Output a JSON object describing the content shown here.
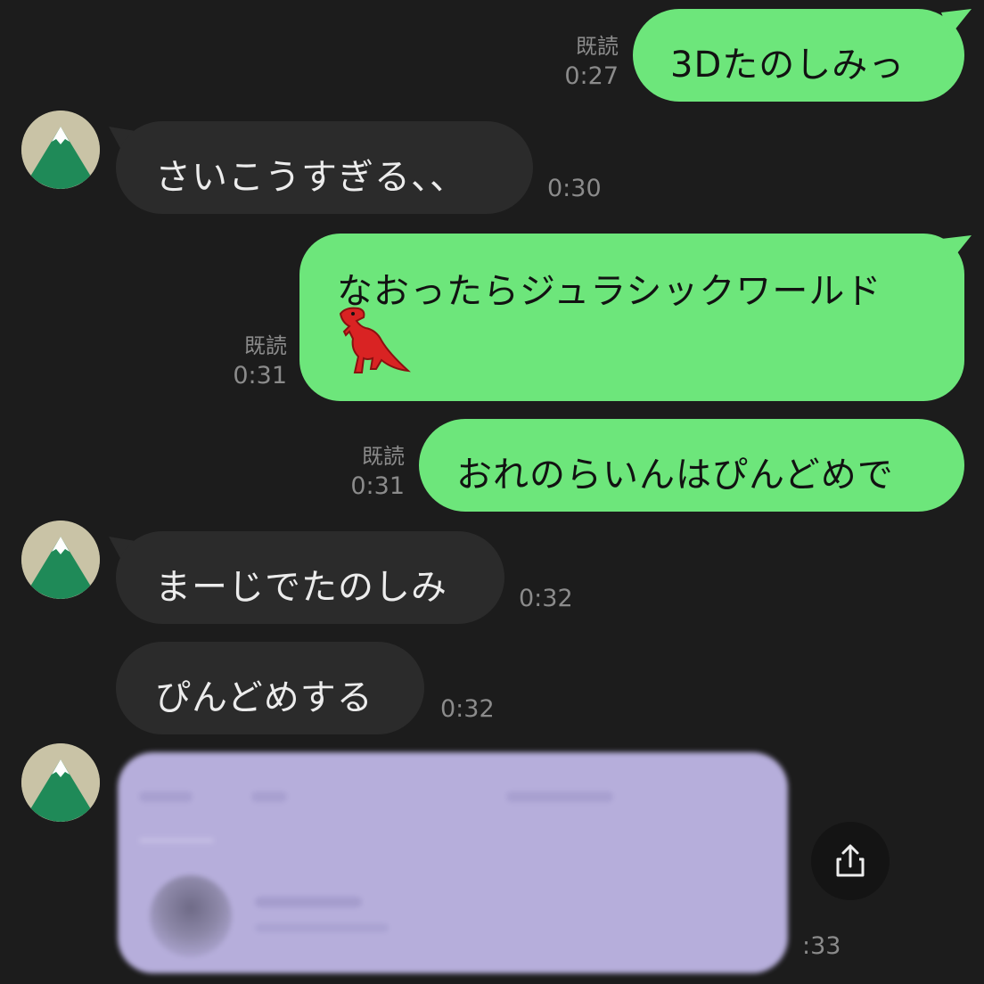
{
  "messages": [
    {
      "side": "out",
      "text": "3Dたのしみっ",
      "read": "既読",
      "time": "0:27"
    },
    {
      "side": "in",
      "text": "さいこうすぎる、、",
      "time": "0:30"
    },
    {
      "side": "out",
      "text": "なおったらジュラシックワールド",
      "emoji": "t-rex-icon",
      "read": "既読",
      "time": "0:31"
    },
    {
      "side": "out",
      "text": "おれのらいんはぴんどめで",
      "read": "既読",
      "time": "0:31"
    },
    {
      "side": "in",
      "text": "まーじでたのしみ",
      "time": "0:32"
    },
    {
      "side": "in",
      "text": "ぴんどめする",
      "time": "0:32"
    },
    {
      "side": "in",
      "type": "link-preview",
      "blurred": true,
      "time": ":33"
    }
  ],
  "icons": {
    "avatar": "mountain-avatar-icon",
    "share": "share-icon",
    "emoji": "t-rex-icon"
  },
  "colors": {
    "background": "#1c1c1c",
    "outgoing": "#6de67b",
    "incoming": "#2b2b2b",
    "preview": "#b6aedb"
  }
}
